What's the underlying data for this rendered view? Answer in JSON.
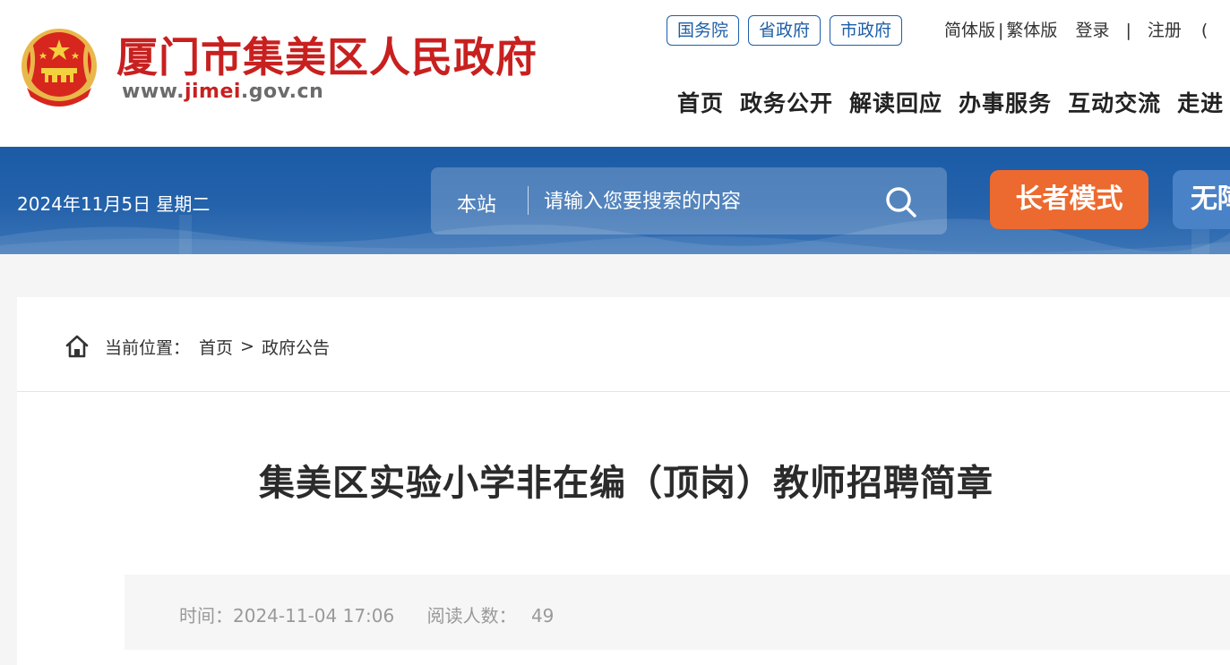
{
  "header": {
    "site_name": "厦门市集美区人民政府",
    "url_prefix": "www.",
    "url_highlight": "jimei",
    "url_suffix": ".gov.cn",
    "gov_links": [
      "国务院",
      "省政府",
      "市政府"
    ],
    "simplified": "简体版",
    "traditional": "繁体版",
    "separator": "|",
    "login": "登录",
    "register": "注册",
    "more_cut": "(",
    "nav": [
      "首页",
      "政务公开",
      "解读回应",
      "办事服务",
      "互动交流",
      "走进"
    ]
  },
  "banner": {
    "date": "2024年11月5日 星期二",
    "search_scope": "本站",
    "search_placeholder": "请输入您要搜索的内容",
    "elder_mode": "长者模式",
    "accessible_mode": "无障"
  },
  "breadcrumb": {
    "prefix": "当前位置：",
    "home": "首页",
    "arrow": ">",
    "current": "政府公告"
  },
  "article": {
    "title": "集美区实验小学非在编（顶岗）教师招聘简章",
    "time_label": "时间：",
    "time_value": "2024-11-04 17:06",
    "reads_label": "阅读人数：",
    "reads_value": "49"
  },
  "colors": {
    "brand_red": "#c8201f",
    "banner_blue": "#1b5ba6",
    "elder_orange": "#ec6a2f",
    "link_blue": "#1d5ea8"
  }
}
